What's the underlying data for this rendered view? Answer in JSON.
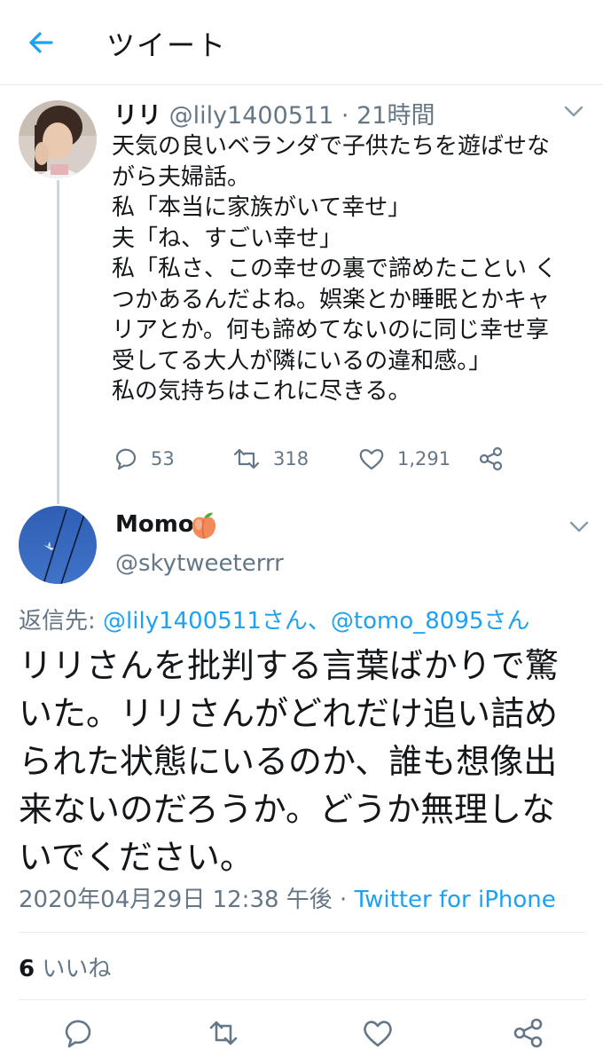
{
  "header": {
    "title": "ツイート"
  },
  "quoted_tweet": {
    "name": "リリ",
    "handle": "@lily1400511",
    "separator": "·",
    "time": "21時間",
    "body_lines": [
      "天気の良いベランダで子供たちを遊ばせな",
      "がら夫婦話。",
      "私「本当に家族がいて幸せ」",
      "夫「ね、すごい幸せ」",
      "私「私さ、この幸せの裏で諦めたことい く",
      "つかあるんだよね。娯楽とか睡眠とかキャ",
      "リアとか。何も諦めてないのに同じ幸せ享",
      "受してる大人が隣にいるの違和感。」",
      "私の気持ちはこれに尽きる。"
    ],
    "replies": "53",
    "retweets": "318",
    "likes": "1,291"
  },
  "reply_tweet": {
    "name": "Momo",
    "handle": "@skytweeterrr",
    "reply_prefix": "返信先: ",
    "reply_to_1": "@lily1400511さん",
    "reply_sep": "、",
    "reply_to_2": "@tomo_8095さん",
    "body_lines": [
      "リリさんを批判する言葉ばかりで驚",
      "いた。リリさんがどれだけ追い詰め",
      "られた状態にいるのか、誰も想像出",
      "来ないのだろうか。どうか無理しな",
      "いでください。"
    ],
    "timestamp": "2020年04月29日 12:38 午後",
    "meta_sep": " · ",
    "source": "Twitter for iPhone",
    "like_count": "6",
    "like_label": " いいね"
  },
  "colors": {
    "accent": "#1da1f2",
    "text": "#14171a",
    "secondary": "#657786",
    "divider": "#e6ecf0"
  },
  "icons": {
    "back": "back-arrow-icon",
    "reply": "reply-icon",
    "retweet": "retweet-icon",
    "like": "heart-icon",
    "share": "share-icon",
    "more": "chevron-down-icon",
    "emoji": "peach-emoji"
  }
}
